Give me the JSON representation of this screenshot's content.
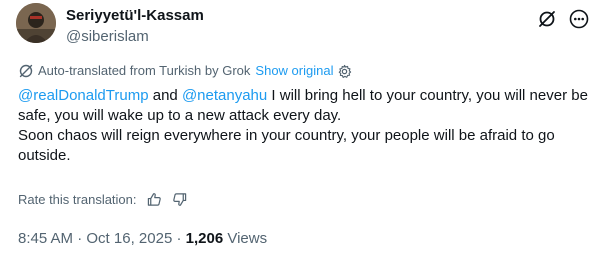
{
  "author": {
    "display_name": "Seriyyetü'l-Kassam",
    "handle": "@siberislam"
  },
  "translation": {
    "note": "Auto-translated from Turkish by Grok",
    "show_original_label": "Show original"
  },
  "tweet": {
    "mention_1": "@realDonaldTrump",
    "connector": " and ",
    "mention_2": "@netanyahu",
    "sentence_1": " I will bring hell to your country, you will never be safe, you will wake up to a new attack every day.",
    "sentence_2": "Soon chaos will reign everywhere in your country, your people will be afraid to go outside."
  },
  "rating": {
    "label": "Rate this translation:"
  },
  "meta": {
    "time": "8:45 AM",
    "separator_1": " · ",
    "date": "Oct 16, 2025",
    "separator_2": " · ",
    "views_count": "1,206",
    "views_label": " Views"
  },
  "icons": {
    "grok": "grok-icon",
    "more": "more-icon",
    "translate": "translate-icon",
    "settings": "gear-icon",
    "thumbs_up": "thumbs-up-icon",
    "thumbs_down": "thumbs-down-icon"
  },
  "colors": {
    "text_primary": "#0f1419",
    "text_secondary": "#536471",
    "link": "#1d9bf0"
  }
}
